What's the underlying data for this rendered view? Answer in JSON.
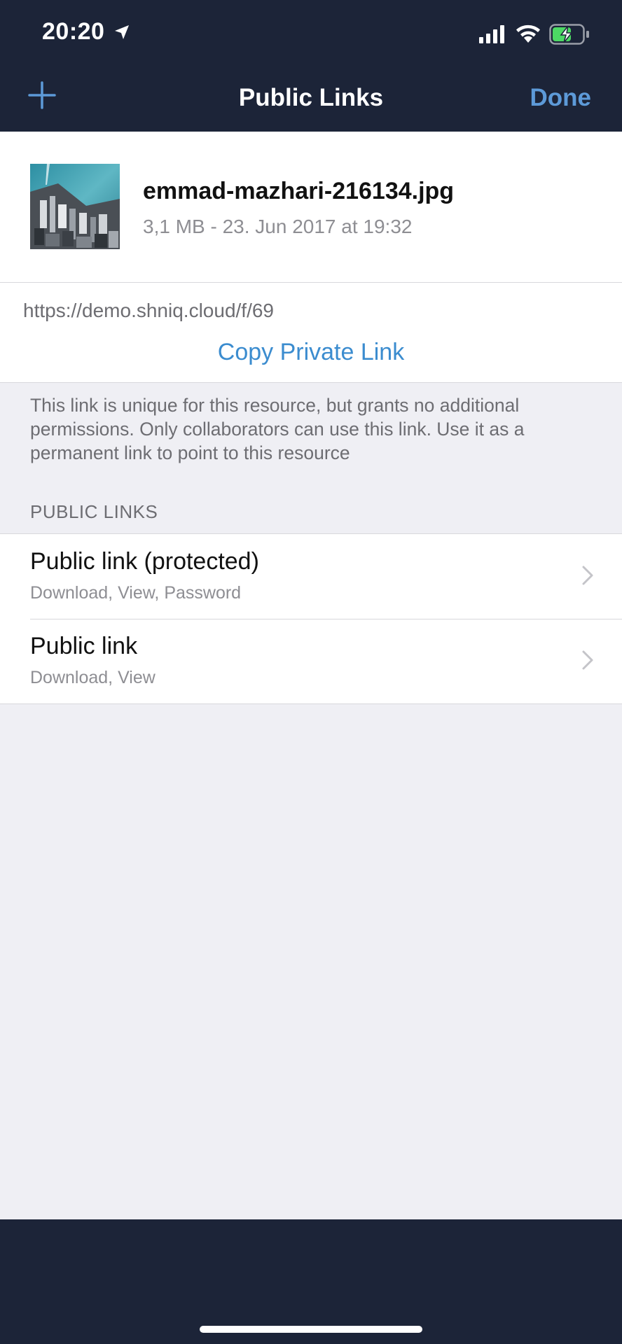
{
  "status_bar": {
    "time": "20:20"
  },
  "nav": {
    "title": "Public Links",
    "done_label": "Done"
  },
  "file": {
    "name": "emmad-mazhari-216134.jpg",
    "meta": "3,1 MB - 23. Jun 2017 at 19:32"
  },
  "private_link": {
    "url": "https://demo.shniq.cloud/f/69",
    "copy_label": "Copy Private Link",
    "note": "This link is unique for this resource, but grants no additional permissions. Only collaborators can use this link. Use it as a permanent link to point to this resource"
  },
  "public_links": {
    "section_header": "PUBLIC LINKS",
    "items": [
      {
        "title": "Public link (protected)",
        "subtitle": "Download, View, Password"
      },
      {
        "title": "Public link",
        "subtitle": "Download, View"
      }
    ]
  },
  "colors": {
    "header_bg": "#1c2438",
    "accent": "#5d9ad8",
    "link_blue": "#3b8ccf",
    "page_bg": "#efeff4"
  }
}
